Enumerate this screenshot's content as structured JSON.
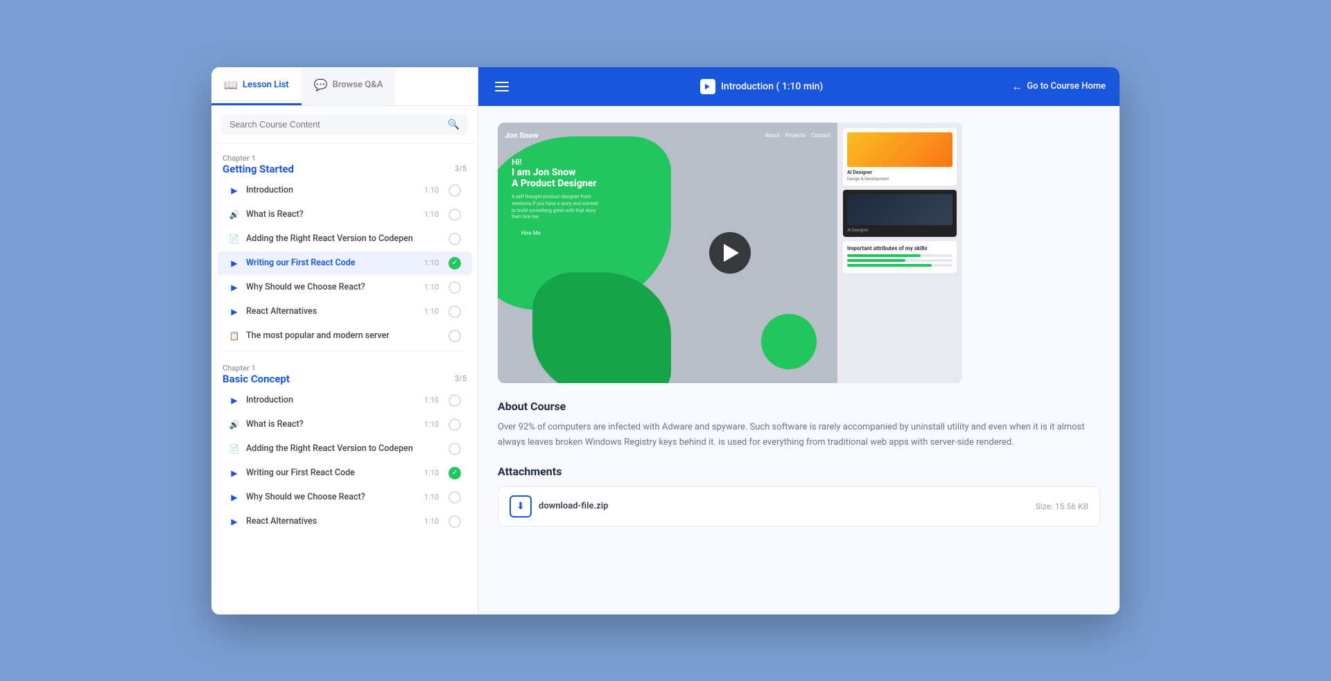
{
  "sidebar": {
    "tab_lesson": "Lesson List",
    "tab_qa": "Browse Q&A",
    "search_placeholder": "Search Course Content",
    "chapters": [
      {
        "id": "ch1",
        "label": "Chapter 1",
        "title": "Getting Started",
        "progress": "3/5",
        "lessons": [
          {
            "id": "l1",
            "type": "video",
            "title": "Introduction",
            "duration": "1:10",
            "checked": false
          },
          {
            "id": "l2",
            "type": "audio",
            "title": "What is React?",
            "duration": "1:10",
            "checked": false
          },
          {
            "id": "l3",
            "type": "doc",
            "title": "Adding the Right React Version to Codepen",
            "duration": "",
            "checked": false
          },
          {
            "id": "l4",
            "type": "video",
            "title": "Writing our First React Code",
            "duration": "1:10",
            "checked": true,
            "active": true
          },
          {
            "id": "l5",
            "type": "video",
            "title": "Why Should we Choose React?",
            "duration": "1:10",
            "checked": false
          },
          {
            "id": "l6",
            "type": "video",
            "title": "React Alternatives",
            "duration": "1:10",
            "checked": false
          },
          {
            "id": "l7",
            "type": "quiz",
            "title": "The most popular and modern server",
            "duration": "",
            "checked": false
          }
        ]
      },
      {
        "id": "ch2",
        "label": "Chapter 1",
        "title": "Basic Concept",
        "progress": "3/5",
        "lessons": [
          {
            "id": "l8",
            "type": "video",
            "title": "Introduction",
            "duration": "1:10",
            "checked": false
          },
          {
            "id": "l9",
            "type": "audio",
            "title": "What is React?",
            "duration": "1:10",
            "checked": false
          },
          {
            "id": "l10",
            "type": "doc",
            "title": "Adding the Right React Version to Codepen",
            "duration": "",
            "checked": false
          },
          {
            "id": "l11",
            "type": "video",
            "title": "Writing our First React Code",
            "duration": "1:10",
            "checked": true
          },
          {
            "id": "l12",
            "type": "video",
            "title": "Why Should we Choose React?",
            "duration": "1:10",
            "checked": false
          },
          {
            "id": "l13",
            "type": "video",
            "title": "React Alternatives",
            "duration": "1:10",
            "checked": false
          }
        ]
      }
    ]
  },
  "topnav": {
    "title": "Introduction ( 1:10 min)",
    "home_link": "Go to Course Home"
  },
  "main": {
    "about_title": "About Course",
    "about_text": "Over 92% of computers are infected with Adware and spyware. Such software is rarely accompanied by uninstall utility and even when it is it almost always leaves broken Windows Registry keys behind it. is used for everything from traditional web apps with server-side rendered.",
    "attachments_title": "Attachments",
    "attachment_filename": "download-file.zip",
    "attachment_size": "Size: 15.56 KB"
  },
  "video": {
    "mock_logo": "Jon Snow",
    "mock_nav_about": "About",
    "mock_nav_projects": "Projects",
    "mock_nav_contact": "Contact",
    "mock_hi": "Hi!",
    "mock_name_line1": "I am Jon Snow",
    "mock_name_line2": "A Product Designer",
    "mock_desc": "A self thought product designer from westeros If you have a story and wanted to build something great with that story then hire me.",
    "mock_btn": "Hire Me",
    "mock_skills": "Important attributes of my skills",
    "skill1_width": "70%",
    "skill2_width": "55%",
    "skill3_width": "80%"
  }
}
